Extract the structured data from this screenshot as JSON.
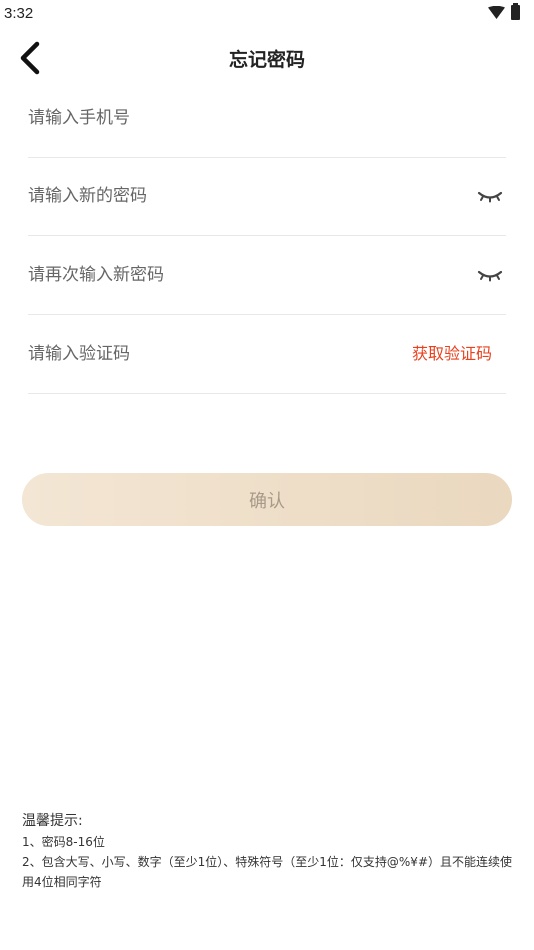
{
  "status_bar": {
    "time": "3:32"
  },
  "header": {
    "title": "忘记密码"
  },
  "form": {
    "phone_placeholder": "请输入手机号",
    "new_password_placeholder": "请输入新的密码",
    "confirm_password_placeholder": "请再次输入新密码",
    "code_placeholder": "请输入验证码",
    "get_code_label": "获取验证码"
  },
  "confirm_button": {
    "label": "确认"
  },
  "tips": {
    "title": "温馨提示:",
    "line1": "1、密码8-16位",
    "line2": "2、包含大写、小写、数字（至少1位）、特殊符号（至少1位：仅支持@%¥#）且不能连续使用4位相同字符"
  },
  "colors": {
    "accent": "#e8411e",
    "button_bg": "#ede0cc",
    "button_text": "#a89a88"
  }
}
